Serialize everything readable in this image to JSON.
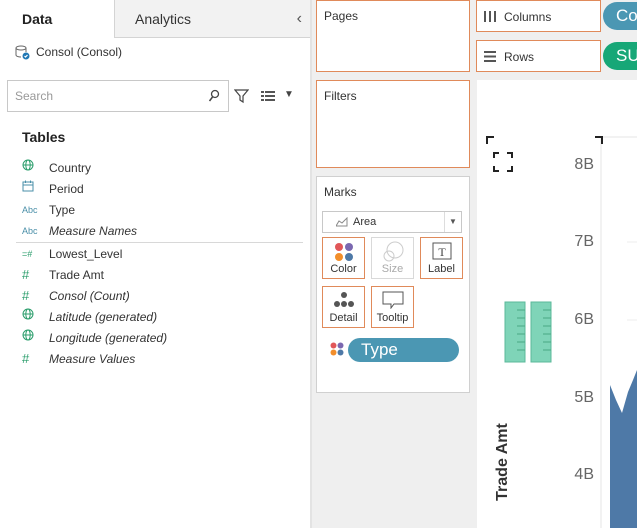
{
  "tabs": {
    "data": "Data",
    "analytics": "Analytics"
  },
  "datasource": "Consol (Consol)",
  "search": {
    "placeholder": "Search"
  },
  "tables_heading": "Tables",
  "fields": [
    {
      "name": "Country",
      "icon": "globe-icon",
      "italic": false
    },
    {
      "name": "Period",
      "icon": "calendar-icon",
      "italic": false
    },
    {
      "name": "Type",
      "icon": "abc-icon",
      "icon_text": "Abc",
      "italic": false
    },
    {
      "name": "Measure Names",
      "icon": "abc-icon",
      "icon_text": "Abc",
      "italic": true
    },
    {
      "name": "Lowest_Level",
      "icon": "hierarchy-number-icon",
      "icon_text": "=#",
      "italic": false
    },
    {
      "name": "Trade Amt",
      "icon": "number-icon",
      "icon_text": "#",
      "italic": false
    },
    {
      "name": "Consol (Count)",
      "icon": "number-icon",
      "icon_text": "#",
      "italic": true
    },
    {
      "name": "Latitude (generated)",
      "icon": "globe-icon",
      "italic": true
    },
    {
      "name": "Longitude (generated)",
      "icon": "globe-icon",
      "italic": true
    },
    {
      "name": "Measure Values",
      "icon": "number-icon",
      "icon_text": "#",
      "italic": true
    }
  ],
  "cards": {
    "pages": "Pages",
    "filters": "Filters",
    "marks": "Marks"
  },
  "marks": {
    "mark_type": "Area",
    "buttons": {
      "color": "Color",
      "size": "Size",
      "label": "Label",
      "detail": "Detail",
      "tooltip": "Tooltip"
    },
    "color_pill": "Type"
  },
  "shelves": {
    "columns": "Columns",
    "rows": "Rows",
    "columns_pill": "Co",
    "rows_pill": "SU"
  },
  "view": {
    "y_axis_title": "Trade Amt",
    "y_ticks": [
      "8B",
      "7B",
      "6B",
      "5B",
      "4B"
    ]
  },
  "colors": {
    "accent_orange": "#e08a5a",
    "pill_blue": "#4b97b3",
    "pill_green": "#17a777",
    "area_blue": "#4e79a7",
    "ghost_green": "#7fd4b8"
  }
}
